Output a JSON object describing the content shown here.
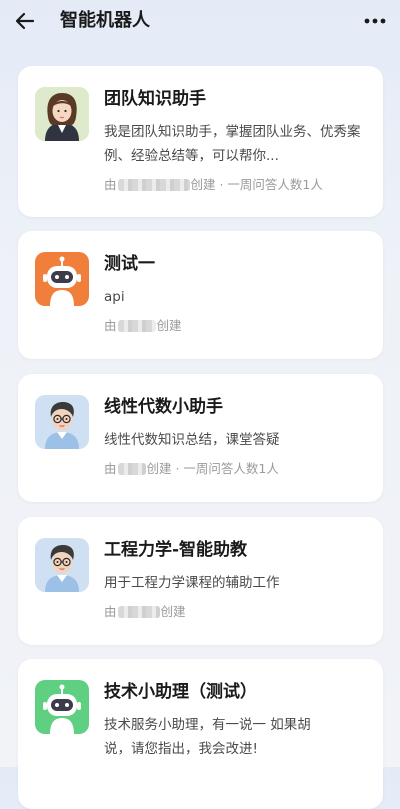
{
  "header": {
    "title": "智能机器人",
    "back_icon": "arrow-left-icon",
    "more_icon": "more-dots-icon"
  },
  "bots": [
    {
      "name": "团队知识助手",
      "avatar": "female-teacher-avatar",
      "description": "我是团队知识助手，掌握团队业务、优秀案例、经验总结等，可以帮你...",
      "meta_prefix": "由",
      "meta_suffix": "创建 · 一周问答人数1人"
    },
    {
      "name": "测试一",
      "avatar": "robot-orange-avatar",
      "description": "api",
      "meta_prefix": "由",
      "meta_suffix": "创建"
    },
    {
      "name": "线性代数小助手",
      "avatar": "male-teacher-avatar",
      "description": "线性代数知识总结，课堂答疑",
      "meta_prefix": "由",
      "meta_suffix": "创建 · 一周问答人数1人"
    },
    {
      "name": "工程力学-智能助教",
      "avatar": "male-teacher-avatar",
      "description": "用于工程力学课程的辅助工作",
      "meta_prefix": "由",
      "meta_suffix": "创建"
    },
    {
      "name": "技术小助理（测试）",
      "avatar": "robot-green-avatar",
      "description": "技术服务小助理，有一说一 如果胡说，请您指出，我会改进!",
      "meta_prefix": "",
      "meta_suffix": ""
    }
  ],
  "colors": {
    "orange_bot": "#f07f3c",
    "green_bot": "#5fcf82",
    "background_top": "#e4ebf7"
  }
}
